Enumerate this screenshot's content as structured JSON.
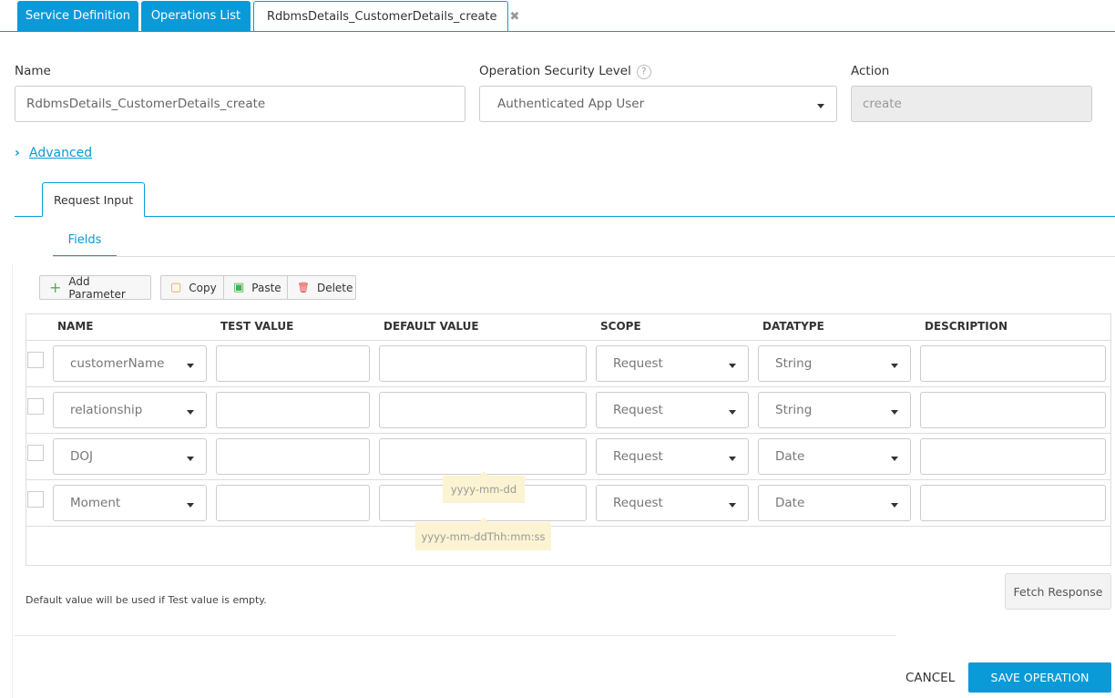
{
  "tabs": [
    {
      "label": "Service Definition"
    },
    {
      "label": "Operations List"
    },
    {
      "label": "RdbmsDetails_CustomerDetails_create",
      "close_icon": "✖"
    }
  ],
  "form": {
    "name_label": "Name",
    "name_value": "RdbmsDetails_CustomerDetails_create",
    "security_label": "Operation Security Level",
    "security_help": "?",
    "security_value": "Authenticated App User",
    "action_label": "Action",
    "action_value": "create"
  },
  "advanced": {
    "icon": "chevron-right-icon",
    "chevron": "›",
    "label": "Advanced"
  },
  "request_tab": "Request Input",
  "fields_tab": "Fields",
  "toolbar": {
    "add": "Add Parameter",
    "add_icon": "+",
    "copy": "Copy",
    "copy_icon": "▢",
    "paste": "Paste",
    "paste_icon": "▣",
    "delete": "Delete",
    "delete_icon": "🗑"
  },
  "table": {
    "headers": [
      "NAME",
      "TEST VALUE",
      "DEFAULT VALUE",
      "SCOPE",
      "DATATYPE",
      "DESCRIPTION"
    ],
    "rows": [
      {
        "name": "customerName",
        "test_value": "",
        "default_value": "",
        "scope": "Request",
        "datatype": "String",
        "description": ""
      },
      {
        "name": "relationship",
        "test_value": "",
        "default_value": "",
        "scope": "Request",
        "datatype": "String",
        "description": ""
      },
      {
        "name": "DOJ",
        "test_value": "",
        "default_value": "",
        "scope": "Request",
        "datatype": "Date",
        "description": ""
      },
      {
        "name": "Moment",
        "test_value": "",
        "default_value": "",
        "scope": "Request",
        "datatype": "Date",
        "description": ""
      }
    ]
  },
  "tooltips": {
    "date": "yyyy-mm-dd",
    "datetime": "yyyy-mm-ddThh:mm:ss"
  },
  "note": "Default value will be used if Test value is empty.",
  "fetch_button": "Fetch Response",
  "cancel_button": "CANCEL",
  "save_button": "SAVE OPERATION",
  "colors": {
    "accent": "#0a9ad8",
    "tooltip_bg": "#fbf3d2"
  }
}
